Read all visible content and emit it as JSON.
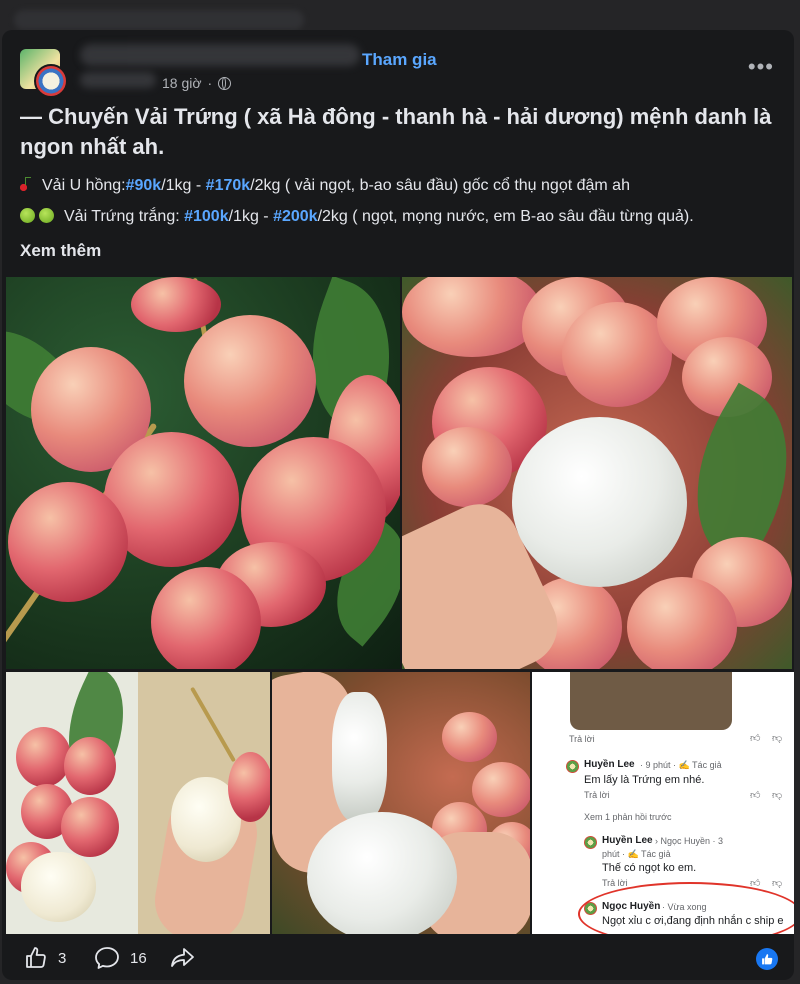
{
  "header": {
    "join_label": "Tham gia",
    "time": "18 giờ",
    "more": "•••"
  },
  "post": {
    "title": "— Chuyến Vải Trứng ( xã Hà đông - thanh hà - hải dương) mệnh danh là ngon nhất ah.",
    "line1": {
      "prefix": "Vải U hồng:",
      "tag1": "#90k",
      "mid1": "/1kg - ",
      "tag2": "#170k",
      "suffix": "/2kg ( vải ngọt, b-ao sâu đầu) gốc cổ thụ ngọt đậm ah"
    },
    "line2": {
      "prefix": "Vải Trứng trắng: ",
      "tag1": "#100k",
      "mid1": "/1kg - ",
      "tag2": "#200k",
      "suffix": "/2kg ( ngọt, mọng nước, em B-ao sâu đầu từng quả)."
    },
    "see_more": "Xem thêm"
  },
  "comments_shot": {
    "reply1": "Trả lời",
    "c1_name": "Huyền Lee",
    "c1_meta": "· 9 phút · ✍ Tác giả",
    "c1_text": "Em lấy là Trứng em nhé.",
    "reply2": "Trả lời",
    "view_reply": "Xem 1 phản hồi trước",
    "c2_name": "Huyền Lee",
    "c2_to": "› Ngọc Huyền · 3",
    "c2_meta": "phút · ✍ Tác giả",
    "c2_text": "Thế có ngọt ko em.",
    "reply3": "Trả lời",
    "c3_name": "Ngọc Huyền",
    "c3_meta": "· Vừa xong",
    "c3_text": "Ngọt xỉu c ơi,đang định nhắn c ship e"
  },
  "footer": {
    "likes": "3",
    "comments": "16"
  },
  "colors": {
    "background": "#18191b",
    "accent": "#5aa7ff",
    "like_blue": "#1877f2"
  }
}
